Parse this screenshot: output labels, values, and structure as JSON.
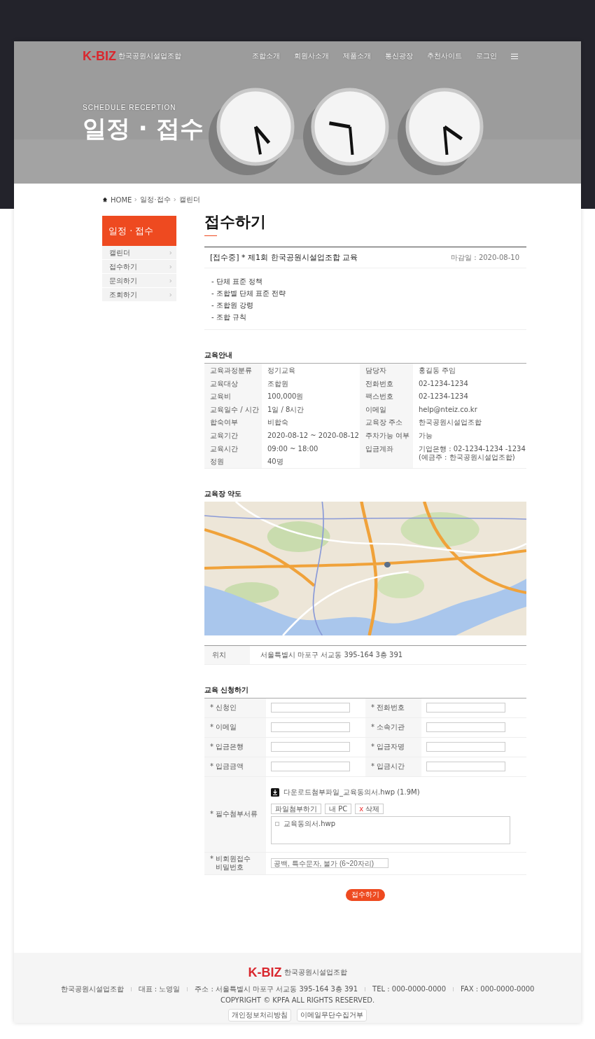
{
  "header": {
    "logo": "K-BIZ",
    "logo_sub": "한국공원시설업조합",
    "nav": [
      "조합소개",
      "회원사소개",
      "제품소개",
      "통신광장",
      "추천사이트",
      "로그인"
    ]
  },
  "hero": {
    "eyebrow": "SCHEDULE RECEPTION",
    "title": "일정 · 접수"
  },
  "breadcrumb": [
    "HOME",
    "일정·접수",
    "캘린더"
  ],
  "sidebar": {
    "title": "일정 · 접수",
    "items": [
      {
        "label": "캘린더",
        "selected": false
      },
      {
        "label": "접수하기",
        "selected": false
      },
      {
        "label": "문의하기",
        "selected": false
      },
      {
        "label": "조회하기",
        "selected": false
      }
    ]
  },
  "page_title": "접수하기",
  "post": {
    "title": "[접수중] * 제1회 한국공원시설업조합 교육",
    "deadline": "마감일 : 2020-08-10",
    "lines": [
      "- 단체 표준 정책",
      "- 조합별 단체 표준 전략",
      "- 조합원 강령",
      "- 조합 규칙"
    ]
  },
  "education_info": {
    "title": "교육안내",
    "left": [
      {
        "label": "교육과정분류",
        "value": [
          "정기교육"
        ]
      },
      {
        "label": "교육대상",
        "value": [
          "조합원"
        ]
      },
      {
        "label": "교육비",
        "value": [
          "100,000원"
        ]
      },
      {
        "label": "교육일수 / 시간",
        "value": [
          "1일 / 8시간"
        ]
      },
      {
        "label": "합숙여부",
        "value": [
          "비합숙"
        ]
      },
      {
        "label": "교육기간",
        "value": [
          "2020-08-12 ~ 2020-08-12"
        ]
      },
      {
        "label": "교육시간",
        "value": [
          "09:00 ~ 18:00"
        ]
      },
      {
        "label": "정원",
        "value": [
          "40명"
        ]
      }
    ],
    "right": [
      {
        "label": "담당자",
        "value": [
          "홍길동 주임"
        ]
      },
      {
        "label": "전화번호",
        "value": [
          "02-1234-1234"
        ]
      },
      {
        "label": "팩스번호",
        "value": [
          "02-1234-1234"
        ]
      },
      {
        "label": "이메일",
        "value": [
          "help@nteiz.co.kr"
        ]
      },
      {
        "label": "교육장 주소",
        "value": [
          "한국공원시설업조합"
        ]
      },
      {
        "label": "주차가능 여부",
        "value": [
          "가능"
        ]
      },
      {
        "label": "입금계좌",
        "value": [
          "기업은행 : 02-1234-1234 -1234",
          "(예금주 : 한국공원시설업조합)"
        ]
      }
    ]
  },
  "map": {
    "title": "교육장 약도",
    "kind": "picture"
  },
  "location": {
    "label": "위치",
    "value": "서울특별시 마포구 서교동 395-164 3층 391"
  },
  "form": {
    "title": "교육 신청하기",
    "fields": [
      {
        "label": "* 신청인"
      },
      {
        "label": "* 전화번호"
      },
      {
        "label": "* 이메일"
      },
      {
        "label": "* 소속기관"
      },
      {
        "label": "* 입금은행"
      },
      {
        "label": "* 입금자명"
      },
      {
        "label": "* 입금금액"
      },
      {
        "label": "* 입금시간"
      }
    ],
    "attachment": {
      "label": "* 필수첨부서류",
      "download": "다운로드첨부파일_교육동의서.hwp (1.9M)",
      "attach_button": "파일첨부하기",
      "pc_button": "내 PC",
      "delete_mark": "x",
      "delete_button": "삭제",
      "files": [
        {
          "name": "교육동의서.hwp",
          "checked": false
        }
      ]
    },
    "password": {
      "label": [
        "* 비회원접수",
        "비밀번호"
      ],
      "placeholder": "공백, 특수문자, 불가 (6~20자리)"
    },
    "submit": "접수하기"
  },
  "footer": {
    "logo": "K-BIZ",
    "logo_sub": "한국공원시설업조합",
    "info": [
      "한국공원시설업조합",
      "대표 : 노영일",
      "주소 : 서울특별시 마포구 서교동 395-164 3층 391",
      "TEL : 000-0000-0000",
      "FAX : 000-0000-0000"
    ],
    "copyright": "COPYRIGHT © KPFA  ALL RIGHTS RESERVED.",
    "links": [
      "개인정보처리방침",
      "이메일무단수집거부"
    ]
  }
}
